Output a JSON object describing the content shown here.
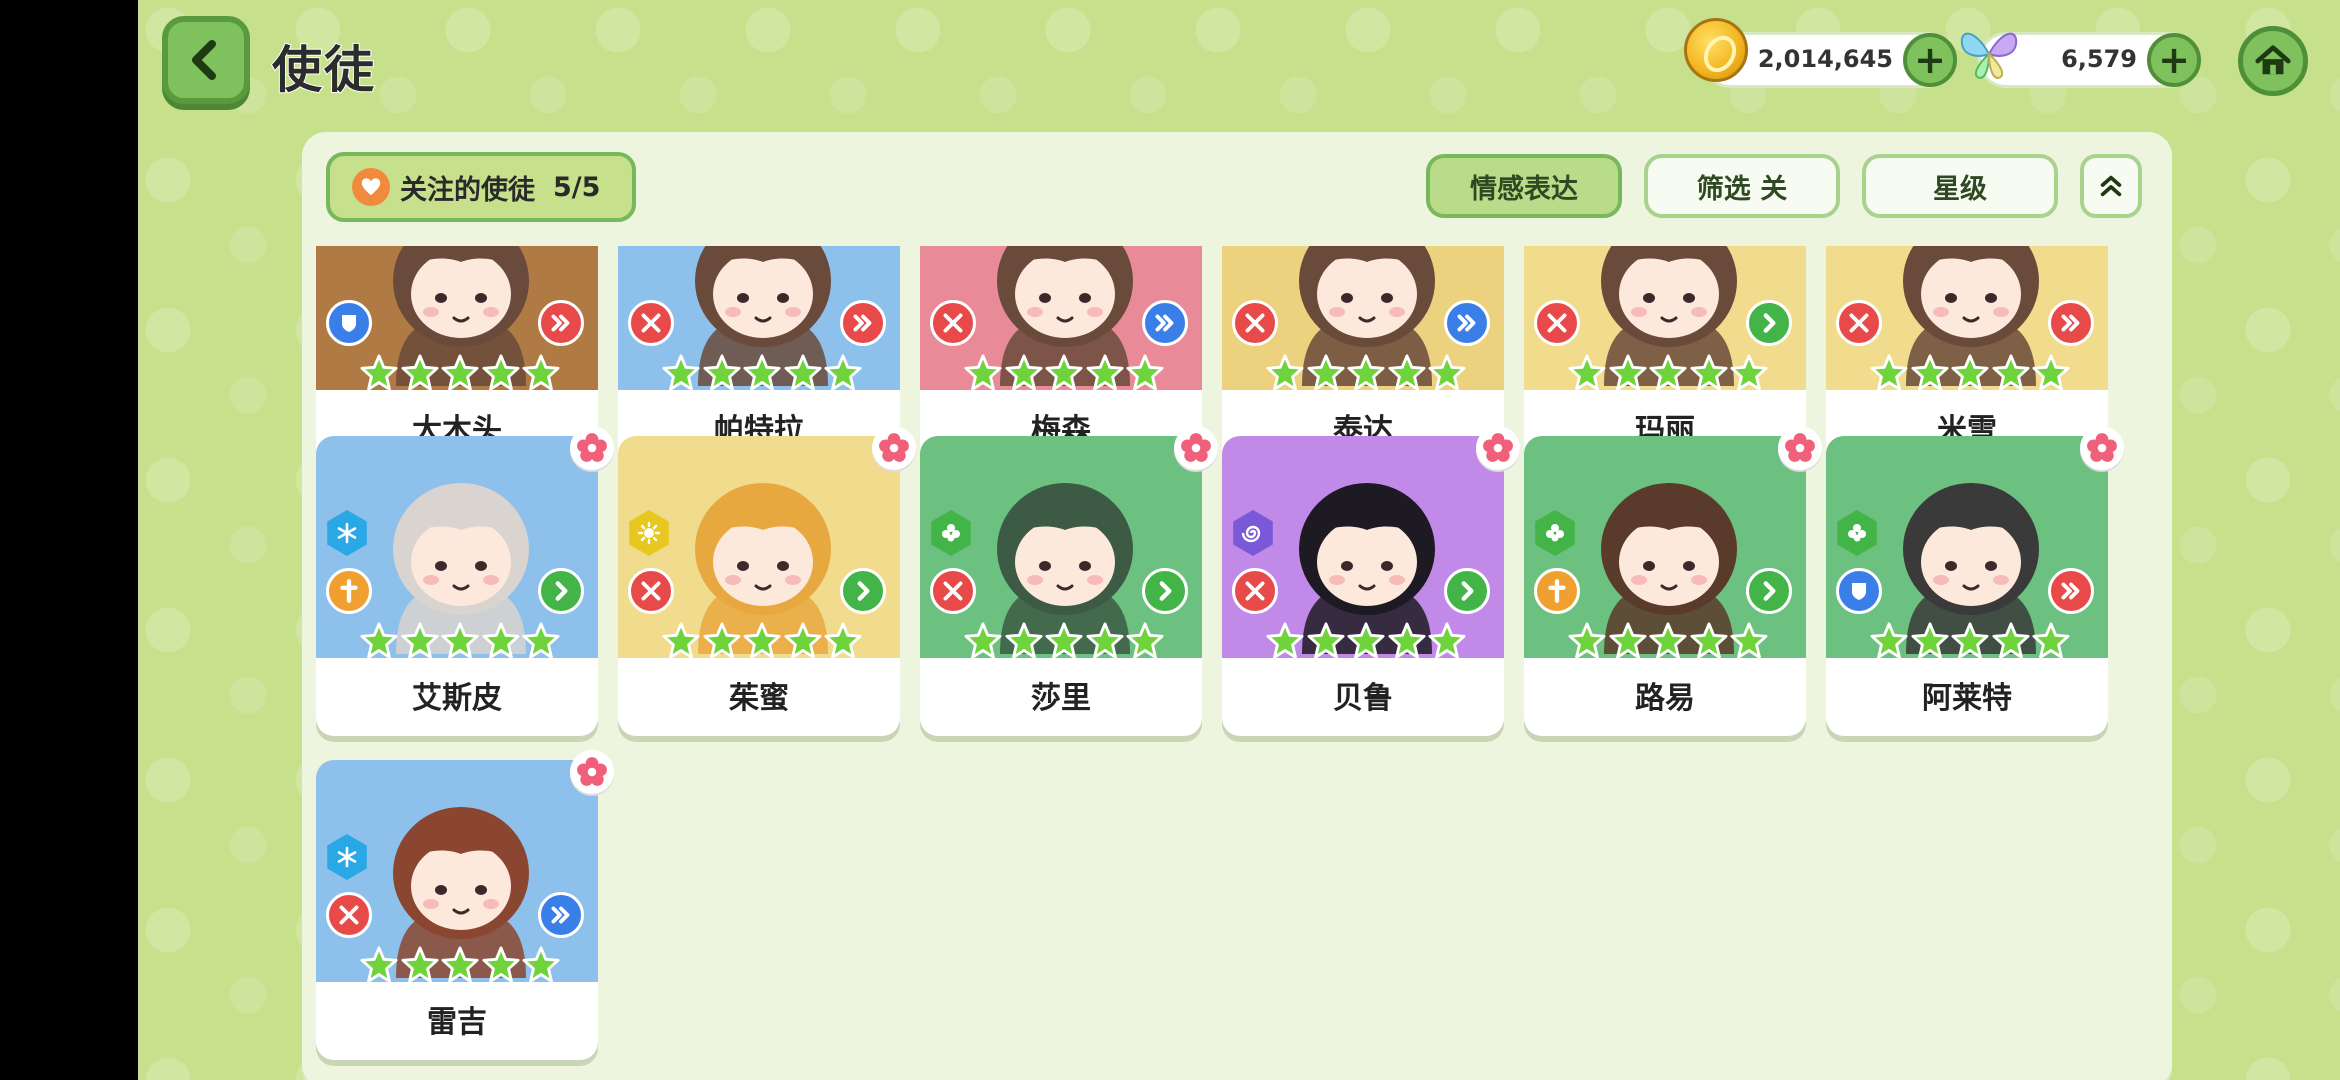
{
  "header": {
    "title": "使徒",
    "coins": "2,014,645",
    "crystals": "6,579"
  },
  "toolbar": {
    "follow_label": "关注的使徒",
    "follow_count": "5/5",
    "filters": [
      {
        "label": "情感表达",
        "active": true
      },
      {
        "label": "筛选 关",
        "active": false
      },
      {
        "label": "星级",
        "active": false
      }
    ]
  },
  "colors": {
    "bg": "#c6e08c",
    "green_btn": "#7fc25d",
    "role_red": "#e84a4a",
    "role_blue": "#3a7ee8",
    "role_green": "#43b548",
    "role_orange": "#f0a030"
  },
  "characters": [
    {
      "name": "大木头",
      "bg": "#b07a44",
      "stars": 5,
      "top_badge": "shield-icon",
      "top_color": "#3a7ee8",
      "right_badge": "double-arrow-icon",
      "right_color": "#e84a4a"
    },
    {
      "name": "帕特拉",
      "bg": "#8ec0ec",
      "stars": 5,
      "top_badge": "crossed-swords-icon",
      "top_color": "#e84a4a",
      "right_badge": "double-arrow-icon",
      "right_color": "#e84a4a"
    },
    {
      "name": "梅森",
      "bg": "#e98a98",
      "stars": 5,
      "top_badge": "crossed-swords-icon",
      "top_color": "#e84a4a",
      "right_badge": "double-arrow-icon",
      "right_color": "#3a7ee8"
    },
    {
      "name": "泰达",
      "bg": "#ecd27e",
      "stars": 5,
      "top_badge": "crossed-swords-icon",
      "top_color": "#e84a4a",
      "right_badge": "double-arrow-icon",
      "right_color": "#3a7ee8"
    },
    {
      "name": "玛丽",
      "bg": "#f0dc8c",
      "stars": 5,
      "top_badge": "crossed-swords-icon",
      "top_color": "#e84a4a",
      "right_badge": "arrow-icon",
      "right_color": "#43b548"
    },
    {
      "name": "米雪",
      "bg": "#f0dc8c",
      "stars": 5,
      "top_badge": "crossed-swords-icon",
      "top_color": "#e84a4a",
      "right_badge": "double-arrow-icon",
      "right_color": "#e84a4a"
    },
    {
      "name": "艾斯皮",
      "bg": "#8ec0ec",
      "stars": 5,
      "element": "snowflake-icon",
      "element_color": "#2aa8e6",
      "top_badge": "cross-icon",
      "top_color": "#f0a030",
      "right_badge": "arrow-icon",
      "right_color": "#43b548",
      "hair": "#d9d4cf"
    },
    {
      "name": "茱蜜",
      "bg": "#f0dc8c",
      "stars": 5,
      "element": "sun-icon",
      "element_color": "#e8c820",
      "top_badge": "crossed-swords-icon",
      "top_color": "#e84a4a",
      "right_badge": "arrow-icon",
      "right_color": "#43b548",
      "hair": "#e8a840"
    },
    {
      "name": "莎里",
      "bg": "#6cc080",
      "stars": 5,
      "element": "clover-icon",
      "element_color": "#43b548",
      "top_badge": "crossed-swords-icon",
      "top_color": "#e84a4a",
      "right_badge": "arrow-icon",
      "right_color": "#43b548",
      "hair": "#3c5a44"
    },
    {
      "name": "贝鲁",
      "bg": "#c28ae8",
      "stars": 5,
      "element": "swirl-icon",
      "element_color": "#7a58d8",
      "top_badge": "crossed-swords-icon",
      "top_color": "#e84a4a",
      "right_badge": "arrow-icon",
      "right_color": "#43b548",
      "hair": "#1e1a24"
    },
    {
      "name": "路易",
      "bg": "#6cc080",
      "stars": 5,
      "element": "clover-icon",
      "element_color": "#43b548",
      "top_badge": "cross-icon",
      "top_color": "#f0a030",
      "right_badge": "arrow-icon",
      "right_color": "#43b548",
      "hair": "#5a3a2a"
    },
    {
      "name": "阿莱特",
      "bg": "#6cc080",
      "stars": 5,
      "element": "clover-icon",
      "element_color": "#43b548",
      "top_badge": "shield-icon",
      "top_color": "#3a7ee8",
      "right_badge": "double-arrow-icon",
      "right_color": "#e84a4a",
      "hair": "#3a3a3a"
    },
    {
      "name": "雷吉",
      "bg": "#8ec0ec",
      "stars": 5,
      "element": "snowflake-icon",
      "element_color": "#2aa8e6",
      "top_badge": "crossed-swords-icon",
      "top_color": "#e84a4a",
      "right_badge": "double-arrow-icon",
      "right_color": "#3a7ee8",
      "hair": "#8a4630"
    }
  ]
}
